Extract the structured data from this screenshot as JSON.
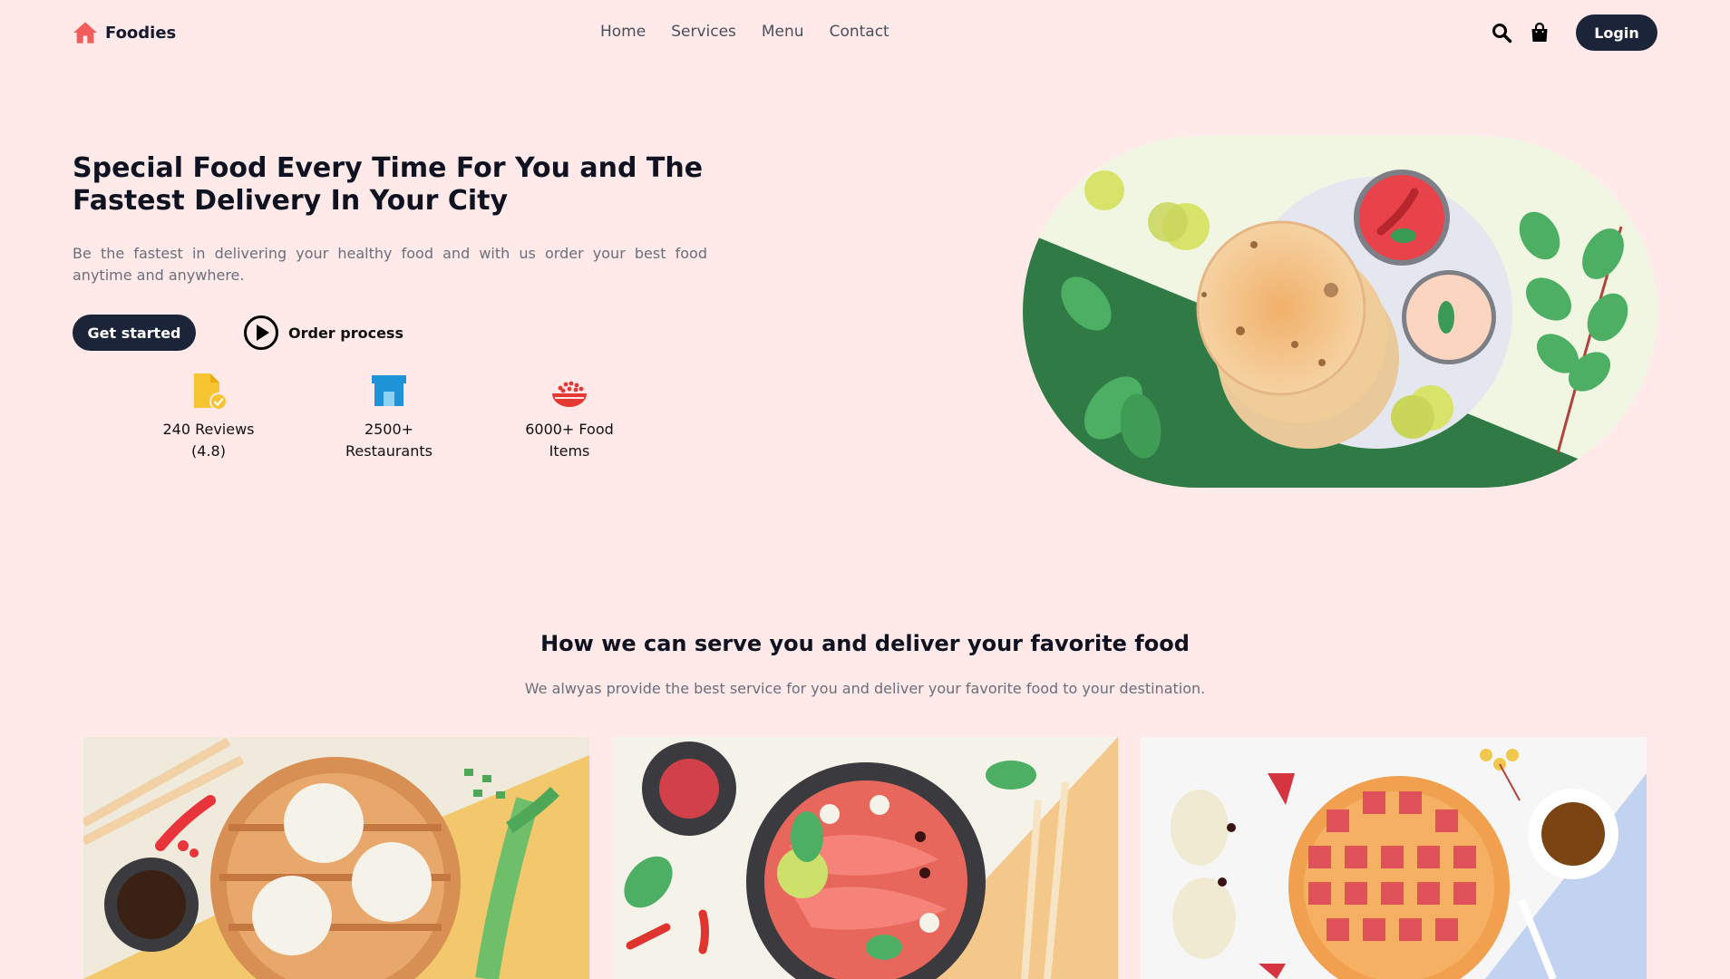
{
  "brand": {
    "name": "Foodies",
    "icon": "home-icon",
    "accent": "#f45b5b"
  },
  "nav": {
    "links": [
      "Home",
      "Services",
      "Menu",
      "Contact"
    ]
  },
  "actions": {
    "search_icon": "search-icon",
    "cart_icon": "shopping-bag-icon",
    "login_label": "Login"
  },
  "hero": {
    "title": "Special Food Every Time For You and The Fastest Delivery In Your City",
    "subtitle": "Be the fastest in delivering your healthy food and with us order your best food anytime and anywhere.",
    "cta_primary": "Get started",
    "cta_secondary": "Order process",
    "stats": [
      {
        "icon": "reviews-document-icon",
        "line1": "240 Reviews",
        "line2": "(4.8)"
      },
      {
        "icon": "store-icon",
        "line1": "2500+",
        "line2": "Restaurants"
      },
      {
        "icon": "food-bowl-icon",
        "line1": "6000+ Food",
        "line2": "Items"
      }
    ]
  },
  "services": {
    "title": "How we can serve you and deliver your favorite food",
    "subtitle": "We alwyas provide the best service for you and deliver your favorite food to your destination."
  },
  "colors": {
    "background": "#ffe9e9",
    "button_dark": "#1b2438",
    "text_muted": "#6a6f7a",
    "leaf_green": "#2f7a45"
  }
}
